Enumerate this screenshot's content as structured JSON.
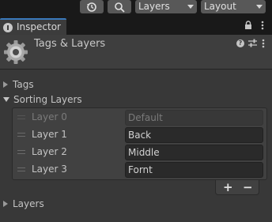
{
  "toolbar": {
    "history_icon": "history-icon",
    "search_icon": "search-icon",
    "layers_dropdown": "Layers",
    "layout_dropdown": "Layout"
  },
  "tab": {
    "label": "Inspector",
    "icon": "info-icon"
  },
  "header": {
    "title": "Tags & Layers",
    "help": "?"
  },
  "sections": {
    "tags": "Tags",
    "sorting_layers": "Sorting Layers",
    "layers": "Layers"
  },
  "sorting_layers": [
    {
      "label": "Layer 0",
      "value": "Default",
      "disabled": true
    },
    {
      "label": "Layer 1",
      "value": "Back",
      "disabled": false
    },
    {
      "label": "Layer 2",
      "value": "Middle",
      "disabled": false
    },
    {
      "label": "Layer 3",
      "value": "Fornt",
      "disabled": false
    }
  ],
  "list_controls": {
    "add": "+",
    "remove": "−"
  },
  "colors": {
    "accent": "#3a79bb",
    "background": "#383838",
    "field": "#2a2a2a"
  }
}
